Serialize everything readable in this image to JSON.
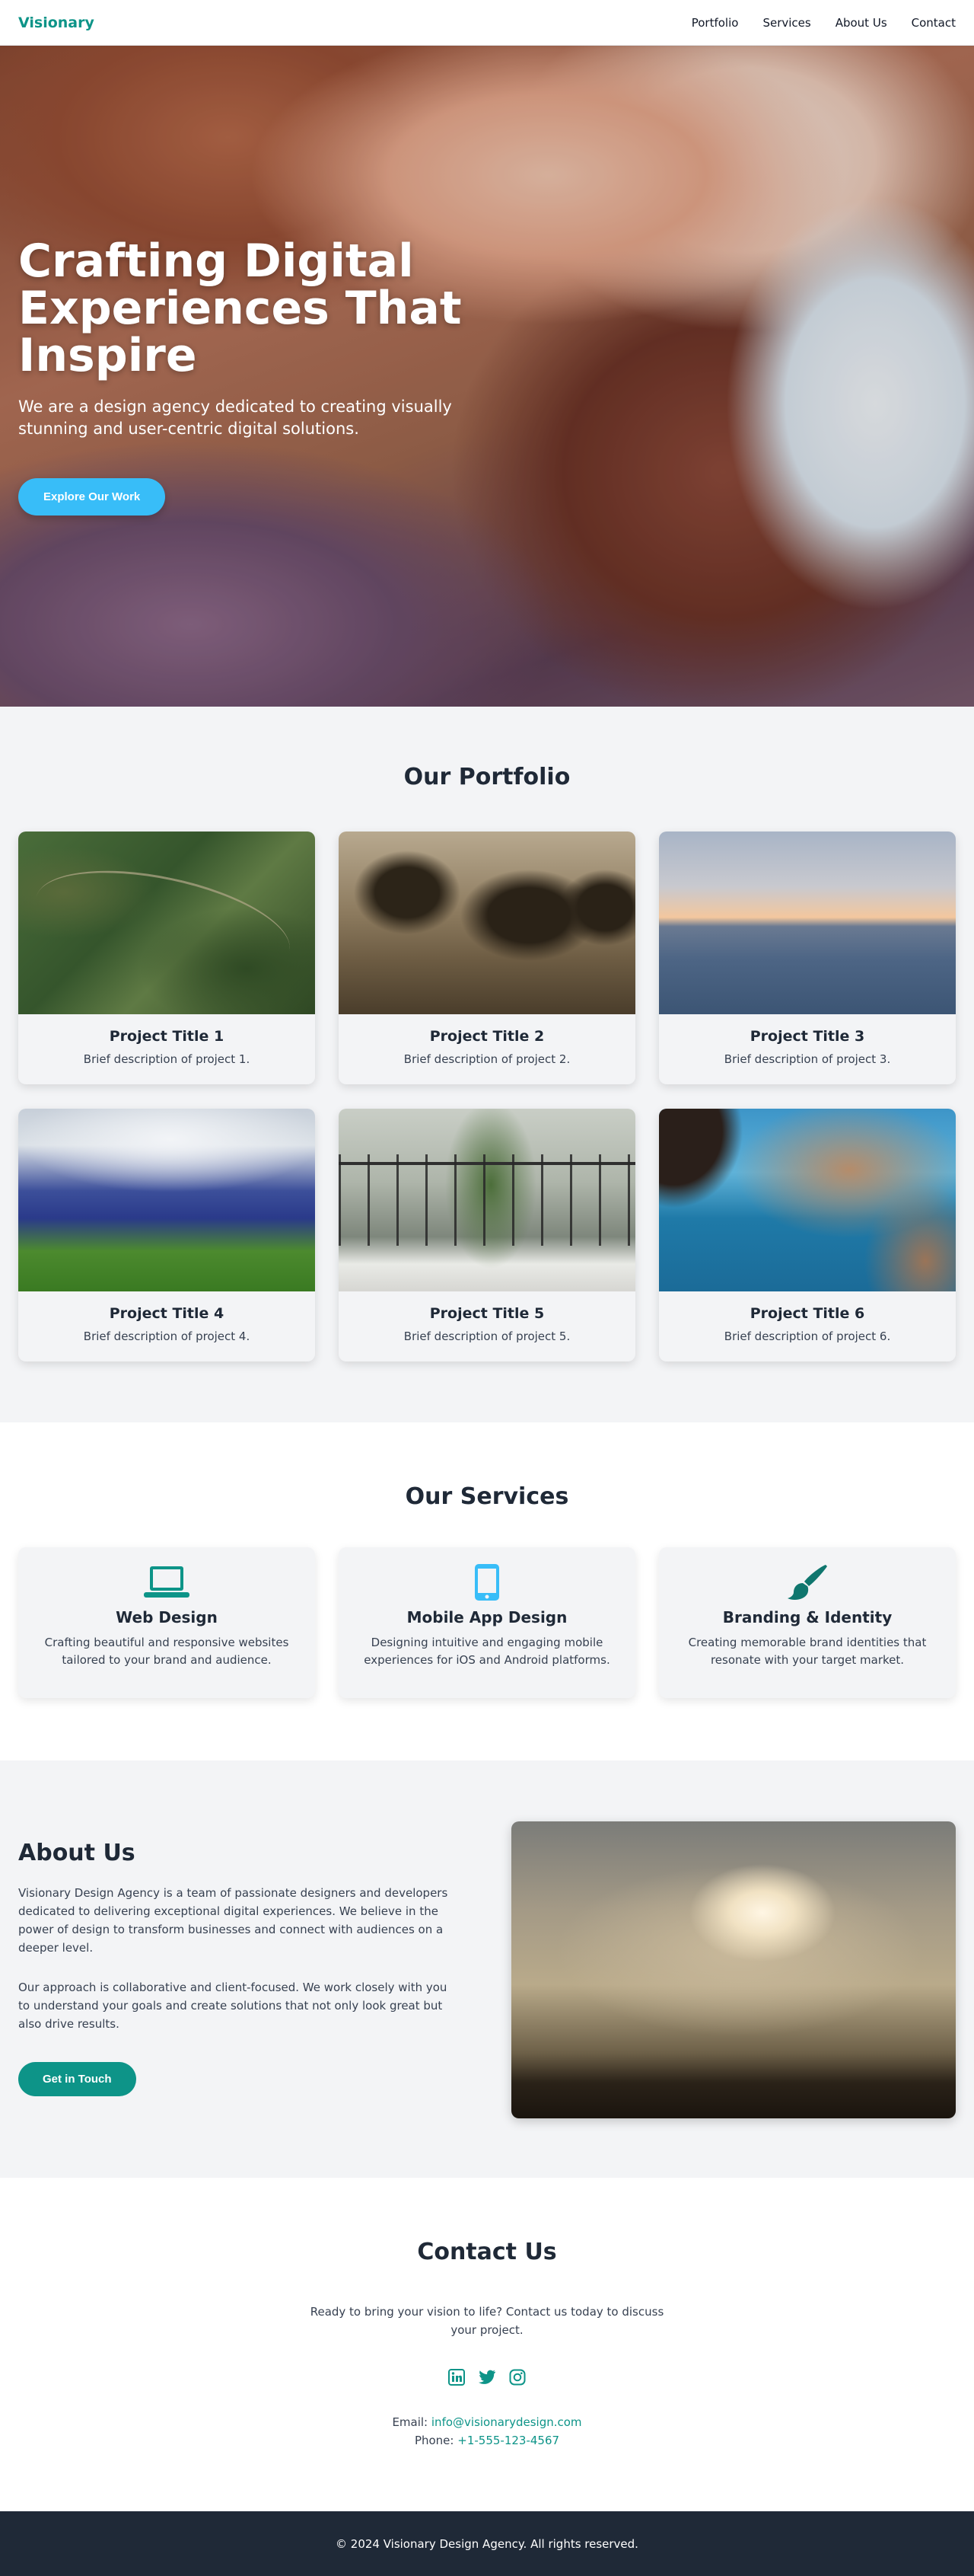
{
  "header": {
    "logo": "Visionary",
    "nav": [
      "Portfolio",
      "Services",
      "About Us",
      "Contact"
    ]
  },
  "hero": {
    "title": "Crafting Digital Experiences That Inspire",
    "subtitle": "We are a design agency dedicated to creating visually stunning and user-centric digital solutions.",
    "cta": "Explore Our Work"
  },
  "portfolio": {
    "title": "Our Portfolio",
    "projects": [
      {
        "title": "Project Title 1",
        "desc": "Brief description of project 1."
      },
      {
        "title": "Project Title 2",
        "desc": "Brief description of project 2."
      },
      {
        "title": "Project Title 3",
        "desc": "Brief description of project 3."
      },
      {
        "title": "Project Title 4",
        "desc": "Brief description of project 4."
      },
      {
        "title": "Project Title 5",
        "desc": "Brief description of project 5."
      },
      {
        "title": "Project Title 6",
        "desc": "Brief description of project 6."
      }
    ]
  },
  "services": {
    "title": "Our Services",
    "items": [
      {
        "icon": "laptop-icon",
        "title": "Web Design",
        "desc": "Crafting beautiful and responsive websites tailored to your brand and audience."
      },
      {
        "icon": "mobile-icon",
        "title": "Mobile App Design",
        "desc": "Designing intuitive and engaging mobile experiences for iOS and Android platforms."
      },
      {
        "icon": "paintbrush-icon",
        "title": "Branding & Identity",
        "desc": "Creating memorable brand identities that resonate with your target market."
      }
    ]
  },
  "about": {
    "title": "About Us",
    "p1": "Visionary Design Agency is a team of passionate designers and developers dedicated to delivering exceptional digital experiences. We believe in the power of design to transform businesses and connect with audiences on a deeper level.",
    "p2": "Our approach is collaborative and client-focused. We work closely with you to understand your goals and create solutions that not only look great but also drive results.",
    "cta": "Get in Touch"
  },
  "contact": {
    "title": "Contact Us",
    "text": "Ready to bring your vision to life? Contact us today to discuss your project.",
    "socials": [
      "linkedin-icon",
      "twitter-icon",
      "instagram-icon"
    ],
    "email_label": "Email:",
    "email": "info@visionarydesign.com",
    "phone_label": "Phone:",
    "phone": "+1-555-123-4567"
  },
  "footer": {
    "text": "© 2024 Visionary Design Agency. All rights reserved."
  },
  "colors": {
    "brand": "#0d9488",
    "accent": "#38bdf8",
    "dark": "#1f2937"
  }
}
